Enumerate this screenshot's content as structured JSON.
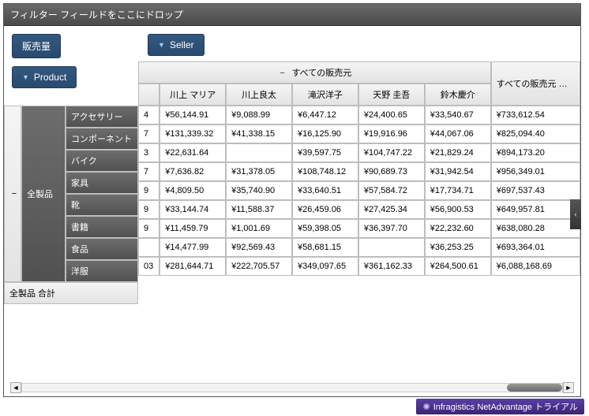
{
  "filter_bar": "フィルター フィールドをここにドロップ",
  "buttons": {
    "sales": "販売量",
    "seller": "Seller",
    "product": "Product"
  },
  "col_group": "すべての販売元",
  "sellers": [
    "川上 マリア",
    "川上良太",
    "滝沢洋子",
    "天野 圭吾",
    "鈴木慶介"
  ],
  "grand_col": "すべての販売元 合計",
  "row_group": "全製品",
  "categories": [
    "アクセサリー",
    "コンポーネント",
    "バイク",
    "家具",
    "靴",
    "書籍",
    "食品",
    "洋服"
  ],
  "first_col_frag": [
    "4",
    "7",
    "3",
    "7",
    "9",
    "9",
    "9",
    ""
  ],
  "data": [
    [
      "¥56,144.91",
      "¥9,088.99",
      "¥6,447.12",
      "¥24,400.65",
      "¥33,540.67",
      "¥733,612.54"
    ],
    [
      "¥131,339.32",
      "¥41,338.15",
      "¥16,125.90",
      "¥19,916.96",
      "¥44,067.06",
      "¥825,094.40"
    ],
    [
      "¥22,631.64",
      "",
      "¥39,597.75",
      "¥104,747.22",
      "¥21,829.24",
      "¥894,173.20"
    ],
    [
      "¥7,636.82",
      "¥31,378.05",
      "¥108,748.12",
      "¥90,689.73",
      "¥31,942.54",
      "¥956,349.01"
    ],
    [
      "¥4,809.50",
      "¥35,740.90",
      "¥33,640.51",
      "¥57,584.72",
      "¥17,734.71",
      "¥697,537.43"
    ],
    [
      "¥33,144.74",
      "¥11,588.37",
      "¥26,459.06",
      "¥27,425.34",
      "¥56,900.53",
      "¥649,957.81"
    ],
    [
      "¥11,459.79",
      "¥1,001.69",
      "¥59,398.05",
      "¥36,397.70",
      "¥22,232.60",
      "¥638,080.28"
    ],
    [
      "¥14,477.99",
      "¥92,569.43",
      "¥58,681.15",
      "",
      "¥36,253.25",
      "¥693,364.01"
    ]
  ],
  "grand_row_label": "全製品  合計",
  "grand_first_frag": "03",
  "grand_row": [
    "¥281,644.71",
    "¥222,705.57",
    "¥349,097.65",
    "¥361,162.33",
    "¥264,500.61",
    "¥6,088,168.69"
  ],
  "trial": "Infragistics NetAdvantage トライアル"
}
